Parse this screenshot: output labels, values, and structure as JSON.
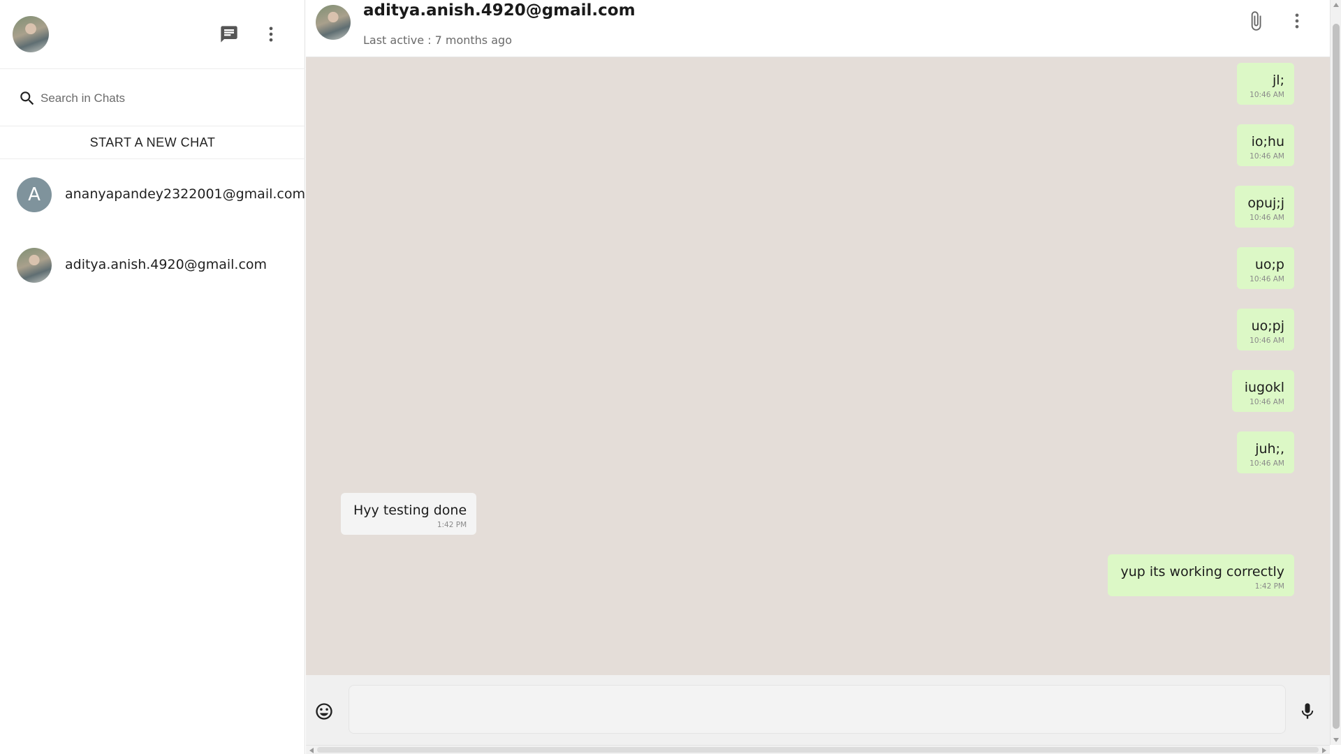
{
  "sidebar": {
    "search": {
      "placeholder": "Search in Chats",
      "value": ""
    },
    "new_chat_label": "START A NEW CHAT",
    "chats": [
      {
        "name": "ananyapandey2322001@gmail.com",
        "avatar_letter": "A",
        "avatar_color": "#7f939c"
      },
      {
        "name": "aditya.anish.4920@gmail.com"
      }
    ],
    "icons": {
      "new_chat": "chat-bubble-icon",
      "menu": "more-vertical-icon",
      "search": "search-icon"
    }
  },
  "conversation": {
    "contact_name": "aditya.anish.4920@gmail.com",
    "status": "Last active : 7 months ago",
    "icons": {
      "attach": "paperclip-icon",
      "menu": "more-vertical-icon"
    },
    "messages": [
      {
        "direction": "out",
        "text": "jl;",
        "time": "10:46 AM"
      },
      {
        "direction": "out",
        "text": "io;hu",
        "time": "10:46 AM"
      },
      {
        "direction": "out",
        "text": "opuj;j",
        "time": "10:46 AM"
      },
      {
        "direction": "out",
        "text": "uo;p",
        "time": "10:46 AM"
      },
      {
        "direction": "out",
        "text": "uo;pj",
        "time": "10:46 AM"
      },
      {
        "direction": "out",
        "text": "iugokl",
        "time": "10:46 AM"
      },
      {
        "direction": "out",
        "text": "juh;,",
        "time": "10:46 AM"
      },
      {
        "direction": "in",
        "text": "Hyy testing done",
        "time": "1:42 PM"
      },
      {
        "direction": "out",
        "text": "yup its working correctly",
        "time": "1:42 PM"
      }
    ]
  },
  "composer": {
    "value": "",
    "icons": {
      "emoji": "emoji-icon",
      "mic": "microphone-icon"
    }
  },
  "colors": {
    "chat_background": "#e4ddd8",
    "outgoing_bubble": "#dcf8c6",
    "incoming_bubble": "#f4f4f4"
  }
}
